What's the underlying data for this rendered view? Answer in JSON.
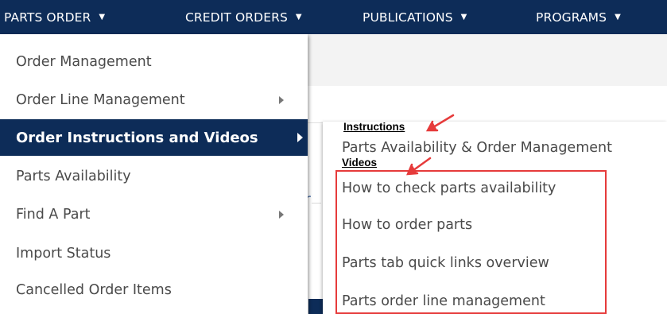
{
  "topnav": {
    "items": [
      {
        "label": "PARTS ORDER"
      },
      {
        "label": "CREDIT ORDERS"
      },
      {
        "label": "PUBLICATIONS"
      },
      {
        "label": "PROGRAMS"
      }
    ]
  },
  "background": {
    "peek_char": "r"
  },
  "menu": {
    "items": [
      {
        "label": "Order Management",
        "has_submenu": false
      },
      {
        "label": "Order Line Management",
        "has_submenu": true
      },
      {
        "label": "Order Instructions and Videos",
        "has_submenu": true,
        "active": true
      },
      {
        "label": "Parts Availability",
        "has_submenu": false
      },
      {
        "label": "Find A Part",
        "has_submenu": true
      },
      {
        "label": "Import Status",
        "has_submenu": false
      },
      {
        "label": "Cancelled Order Items",
        "has_submenu": false
      }
    ]
  },
  "submenu": {
    "instructions_heading": "Instructions",
    "instructions_items": [
      "Parts Availability & Order Management"
    ],
    "videos_heading": "Videos",
    "videos_items": [
      "How to check parts availability",
      "How to order parts",
      "Parts tab quick links overview",
      "Parts order line management"
    ]
  },
  "colors": {
    "nav_background": "#0d2c58",
    "active_item_background": "#0d2c58",
    "menu_text": "#4a4a4a",
    "annotation_red": "#e63b3b"
  }
}
